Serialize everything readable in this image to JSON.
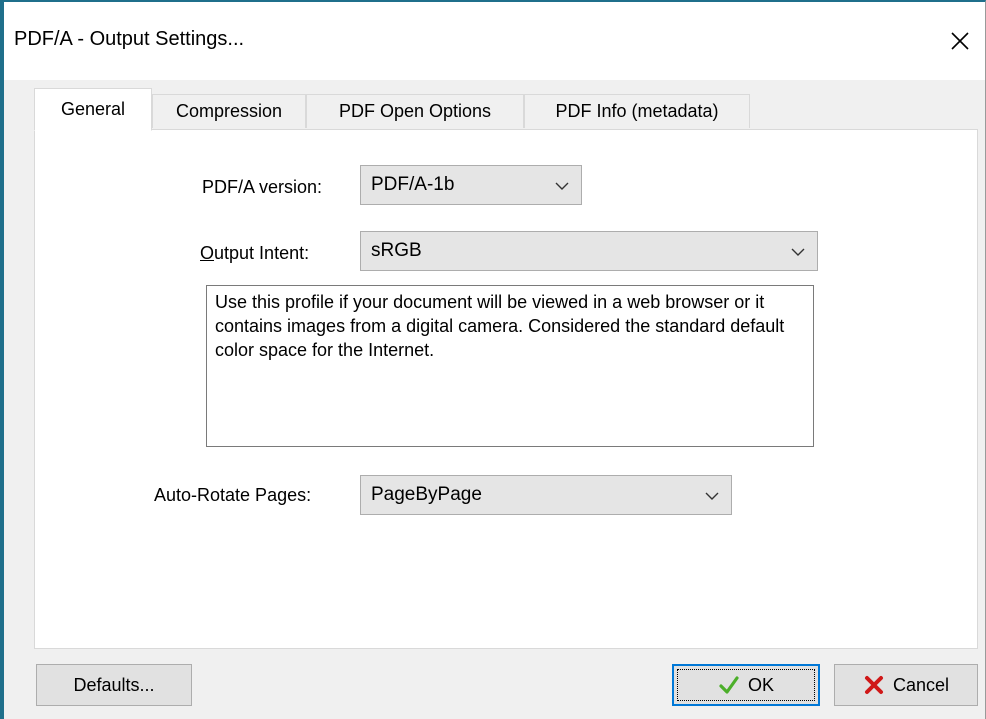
{
  "window": {
    "title": "PDF/A - Output Settings..."
  },
  "tabs": [
    {
      "label": "General",
      "active": true
    },
    {
      "label": "Compression",
      "active": false
    },
    {
      "label": "PDF Open Options",
      "active": false
    },
    {
      "label": "PDF Info (metadata)",
      "active": false
    }
  ],
  "general": {
    "pdfa_version": {
      "label": "PDF/A version:",
      "value": "PDF/A-1b"
    },
    "output_intent": {
      "label": "Output Intent:",
      "value": "sRGB"
    },
    "description": "Use this profile if your document will be viewed in a web browser or it contains images from a digital camera. Considered the standard default color space for the Internet.",
    "auto_rotate": {
      "label": "Auto-Rotate Pages:",
      "value": "PageByPage"
    }
  },
  "buttons": {
    "defaults": "Defaults...",
    "ok": "OK",
    "cancel": "Cancel"
  },
  "colors": {
    "window_border": "#1f6f8b",
    "default_button_border": "#0078d7",
    "ok_icon": "#4caf2a",
    "cancel_icon": "#d01818"
  },
  "icons": {
    "close": "close-icon",
    "chevron": "chevron-down-icon",
    "ok": "check-icon",
    "cancel": "x-icon"
  }
}
